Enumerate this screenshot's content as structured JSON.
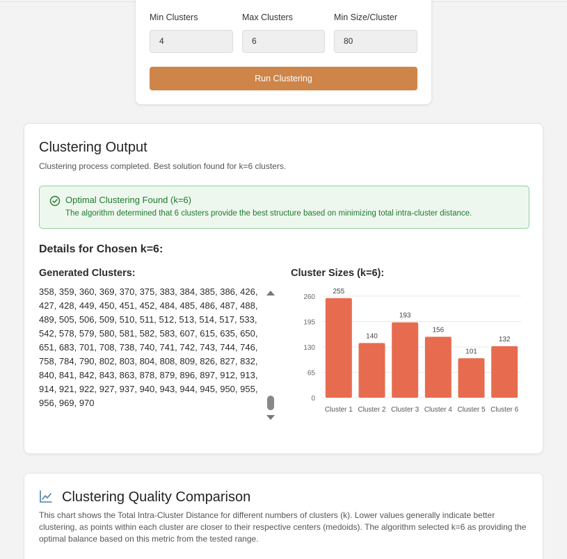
{
  "settings": {
    "min_clusters_label": "Min Clusters",
    "max_clusters_label": "Max Clusters",
    "min_size_label": "Min Size/Cluster",
    "min_clusters_value": "4",
    "max_clusters_value": "6",
    "min_size_value": "80",
    "run_button": "Run Clustering",
    "accent_color": "#cd854a"
  },
  "output": {
    "title": "Clustering Output",
    "subtitle": "Clustering process completed. Best solution found for k=6 clusters.",
    "success_title": "Optimal Clustering Found (k=6)",
    "success_text": "The algorithm determined that 6 clusters provide the best structure based on minimizing total intra-cluster distance.",
    "success_color": "#1d7a2e",
    "details_title": "Details for Chosen k=6:",
    "generated_title": "Generated Clusters:",
    "clusters_text": "358, 359, 360, 369, 370, 375, 383, 384, 385, 386, 426, 427, 428, 449, 450, 451, 452, 484, 485, 486, 487, 488, 489, 505, 506, 509, 510, 511, 512, 513, 514, 517, 533, 542, 578, 579, 580, 581, 582, 583, 607, 615, 635, 650, 651, 683, 701, 708, 738, 740, 741, 742, 743, 744, 746, 758, 784, 790, 802, 803, 804, 808, 809, 826, 827, 832, 840, 841, 842, 843, 863, 878, 879, 896, 897, 912, 913, 914, 921, 922, 927, 937, 940, 943, 944, 945, 950, 955, 956, 969, 970",
    "sizes_title": "Cluster Sizes (k=6):"
  },
  "chart_data": {
    "type": "bar",
    "title": "Cluster Sizes (k=6):",
    "categories": [
      "Cluster 1",
      "Cluster 2",
      "Cluster 3",
      "Cluster 4",
      "Cluster 5",
      "Cluster 6"
    ],
    "values": [
      255,
      140,
      193,
      156,
      101,
      132
    ],
    "yticks": [
      "0",
      "65",
      "130",
      "195",
      "260"
    ],
    "ylim": [
      0,
      260
    ],
    "grid": true,
    "bar_color": "#e76c4f"
  },
  "quality": {
    "icon": "line-chart-icon",
    "title": "Clustering Quality Comparison",
    "text": "This chart shows the Total Intra-Cluster Distance for different numbers of clusters (k). Lower values generally indicate better clustering, as points within each cluster are closer to their respective centers (medoids). The algorithm selected k=6 as providing the optimal balance based on this metric from the tested range."
  }
}
